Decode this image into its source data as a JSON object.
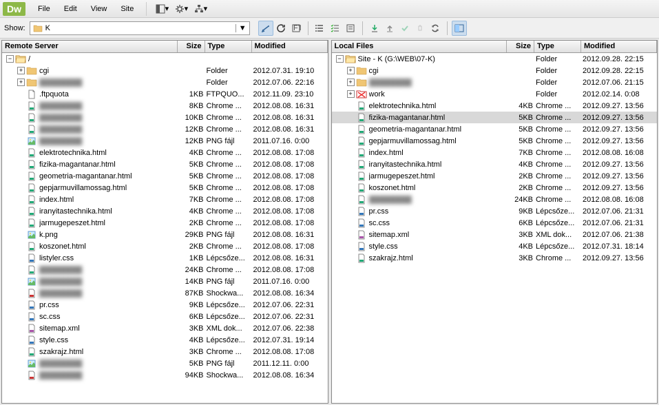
{
  "app": {
    "logo": "Dw"
  },
  "menu": [
    "File",
    "Edit",
    "View",
    "Site"
  ],
  "subbar": {
    "show_label": "Show:",
    "site_name": "K"
  },
  "panels": {
    "remote": {
      "title": "Remote Server",
      "cols": {
        "size": "Size",
        "type": "Type",
        "mod": "Modified"
      },
      "root": {
        "name": "/"
      },
      "rows": [
        {
          "indent": 1,
          "exp": "+",
          "ico": "folder",
          "name": "cgi",
          "size": "",
          "type": "Folder",
          "mod": "2012.07.31. 19:10"
        },
        {
          "indent": 1,
          "exp": "+",
          "ico": "folder",
          "name": "",
          "size": "",
          "type": "Folder",
          "mod": "2012.07.06. 22:16",
          "blur": true
        },
        {
          "indent": 1,
          "ico": "file",
          "name": ".ftpquota",
          "size": "1KB",
          "type": "FTPQUO...",
          "mod": "2012.11.09. 23:10"
        },
        {
          "indent": 1,
          "ico": "html",
          "name": "",
          "size": "8KB",
          "type": "Chrome ...",
          "mod": "2012.08.08. 16:31",
          "blur": true
        },
        {
          "indent": 1,
          "ico": "html",
          "name": "",
          "size": "10KB",
          "type": "Chrome ...",
          "mod": "2012.08.08. 16:31",
          "blur": true
        },
        {
          "indent": 1,
          "ico": "html",
          "name": "",
          "size": "12KB",
          "type": "Chrome ...",
          "mod": "2012.08.08. 16:31",
          "blur": true
        },
        {
          "indent": 1,
          "ico": "png",
          "name": "",
          "size": "12KB",
          "type": "PNG fájl",
          "mod": "2011.07.16. 0:00",
          "blur": true
        },
        {
          "indent": 1,
          "ico": "html",
          "name": "elektrotechnika.html",
          "size": "4KB",
          "type": "Chrome ...",
          "mod": "2012.08.08. 17:08"
        },
        {
          "indent": 1,
          "ico": "html",
          "name": "fizika-magantanar.html",
          "size": "5KB",
          "type": "Chrome ...",
          "mod": "2012.08.08. 17:08"
        },
        {
          "indent": 1,
          "ico": "html",
          "name": "geometria-magantanar.html",
          "size": "5KB",
          "type": "Chrome ...",
          "mod": "2012.08.08. 17:08"
        },
        {
          "indent": 1,
          "ico": "html",
          "name": "gepjarmuvillamossag.html",
          "size": "5KB",
          "type": "Chrome ...",
          "mod": "2012.08.08. 17:08"
        },
        {
          "indent": 1,
          "ico": "html",
          "name": "index.html",
          "size": "7KB",
          "type": "Chrome ...",
          "mod": "2012.08.08. 17:08"
        },
        {
          "indent": 1,
          "ico": "html",
          "name": "iranyitastechnika.html",
          "size": "4KB",
          "type": "Chrome ...",
          "mod": "2012.08.08. 17:08"
        },
        {
          "indent": 1,
          "ico": "html",
          "name": "jarmugepeszet.html",
          "size": "2KB",
          "type": "Chrome ...",
          "mod": "2012.08.08. 17:08"
        },
        {
          "indent": 1,
          "ico": "png",
          "name": "k.png",
          "size": "29KB",
          "type": "PNG fájl",
          "mod": "2012.08.08. 16:31"
        },
        {
          "indent": 1,
          "ico": "html",
          "name": "koszonet.html",
          "size": "2KB",
          "type": "Chrome ...",
          "mod": "2012.08.08. 17:08"
        },
        {
          "indent": 1,
          "ico": "css",
          "name": "listyler.css",
          "size": "1KB",
          "type": "Lépcsőze...",
          "mod": "2012.08.08. 16:31"
        },
        {
          "indent": 1,
          "ico": "html",
          "name": "",
          "size": "24KB",
          "type": "Chrome ...",
          "mod": "2012.08.08. 17:08",
          "blur": true
        },
        {
          "indent": 1,
          "ico": "png",
          "name": "",
          "size": "14KB",
          "type": "PNG fájl",
          "mod": "2011.07.16. 0:00",
          "blur": true
        },
        {
          "indent": 1,
          "ico": "swf",
          "name": "",
          "size": "87KB",
          "type": "Shockwa...",
          "mod": "2012.08.08. 16:34",
          "blur": true
        },
        {
          "indent": 1,
          "ico": "css",
          "name": "pr.css",
          "size": "9KB",
          "type": "Lépcsőze...",
          "mod": "2012.07.06. 22:31"
        },
        {
          "indent": 1,
          "ico": "css",
          "name": "sc.css",
          "size": "6KB",
          "type": "Lépcsőze...",
          "mod": "2012.07.06. 22:31"
        },
        {
          "indent": 1,
          "ico": "xml",
          "name": "sitemap.xml",
          "size": "3KB",
          "type": "XML dok...",
          "mod": "2012.07.06. 22:38"
        },
        {
          "indent": 1,
          "ico": "css",
          "name": "style.css",
          "size": "4KB",
          "type": "Lépcsőze...",
          "mod": "2012.07.31. 19:14"
        },
        {
          "indent": 1,
          "ico": "html",
          "name": "szakrajz.html",
          "size": "3KB",
          "type": "Chrome ...",
          "mod": "2012.08.08. 17:08"
        },
        {
          "indent": 1,
          "ico": "png",
          "name": "",
          "size": "5KB",
          "type": "PNG fájl",
          "mod": "2011.12.11. 0:00",
          "blur": true
        },
        {
          "indent": 1,
          "ico": "swf",
          "name": "",
          "size": "94KB",
          "type": "Shockwa...",
          "mod": "2012.08.08. 16:34",
          "blur": true
        }
      ]
    },
    "local": {
      "title": "Local Files",
      "cols": {
        "size": "Size",
        "type": "Type",
        "mod": "Modified"
      },
      "root": {
        "name": "Site - K (G:\\WEB\\07-K)",
        "type": "Folder",
        "mod": "2012.09.28. 22:15"
      },
      "rows": [
        {
          "indent": 1,
          "exp": "+",
          "ico": "folder",
          "name": "cgi",
          "size": "",
          "type": "Folder",
          "mod": "2012.09.28. 22:15"
        },
        {
          "indent": 1,
          "exp": "+",
          "ico": "folder",
          "name": "",
          "size": "",
          "type": "Folder",
          "mod": "2012.07.06. 21:15",
          "blur": true
        },
        {
          "indent": 1,
          "exp": "+",
          "ico": "folder-red",
          "name": "work",
          "size": "",
          "type": "Folder",
          "mod": "2012.02.14. 0:08"
        },
        {
          "indent": 1,
          "ico": "html",
          "name": "elektrotechnika.html",
          "size": "4KB",
          "type": "Chrome ...",
          "mod": "2012.09.27. 13:56"
        },
        {
          "indent": 1,
          "ico": "html",
          "name": "fizika-magantanar.html",
          "size": "5KB",
          "type": "Chrome ...",
          "mod": "2012.09.27. 13:56",
          "selected": true
        },
        {
          "indent": 1,
          "ico": "html",
          "name": "geometria-magantanar.html",
          "size": "5KB",
          "type": "Chrome ...",
          "mod": "2012.09.27. 13:56"
        },
        {
          "indent": 1,
          "ico": "html",
          "name": "gepjarmuvillamossag.html",
          "size": "5KB",
          "type": "Chrome ...",
          "mod": "2012.09.27. 13:56"
        },
        {
          "indent": 1,
          "ico": "html",
          "name": "index.html",
          "size": "7KB",
          "type": "Chrome ...",
          "mod": "2012.08.08. 16:08"
        },
        {
          "indent": 1,
          "ico": "html",
          "name": "iranyitastechnika.html",
          "size": "4KB",
          "type": "Chrome ...",
          "mod": "2012.09.27. 13:56"
        },
        {
          "indent": 1,
          "ico": "html",
          "name": "jarmugepeszet.html",
          "size": "2KB",
          "type": "Chrome ...",
          "mod": "2012.09.27. 13:56"
        },
        {
          "indent": 1,
          "ico": "html",
          "name": "koszonet.html",
          "size": "2KB",
          "type": "Chrome ...",
          "mod": "2012.09.27. 13:56"
        },
        {
          "indent": 1,
          "ico": "html",
          "name": "",
          "size": "24KB",
          "type": "Chrome ...",
          "mod": "2012.08.08. 16:08",
          "blur": true
        },
        {
          "indent": 1,
          "ico": "css",
          "name": "pr.css",
          "size": "9KB",
          "type": "Lépcsőze...",
          "mod": "2012.07.06. 21:31"
        },
        {
          "indent": 1,
          "ico": "css",
          "name": "sc.css",
          "size": "6KB",
          "type": "Lépcsőze...",
          "mod": "2012.07.06. 21:31"
        },
        {
          "indent": 1,
          "ico": "xml",
          "name": "sitemap.xml",
          "size": "3KB",
          "type": "XML dok...",
          "mod": "2012.07.06. 21:38"
        },
        {
          "indent": 1,
          "ico": "css",
          "name": "style.css",
          "size": "4KB",
          "type": "Lépcsőze...",
          "mod": "2012.07.31. 18:14"
        },
        {
          "indent": 1,
          "ico": "html",
          "name": "szakrajz.html",
          "size": "3KB",
          "type": "Chrome ...",
          "mod": "2012.09.27. 13:56"
        }
      ]
    }
  }
}
